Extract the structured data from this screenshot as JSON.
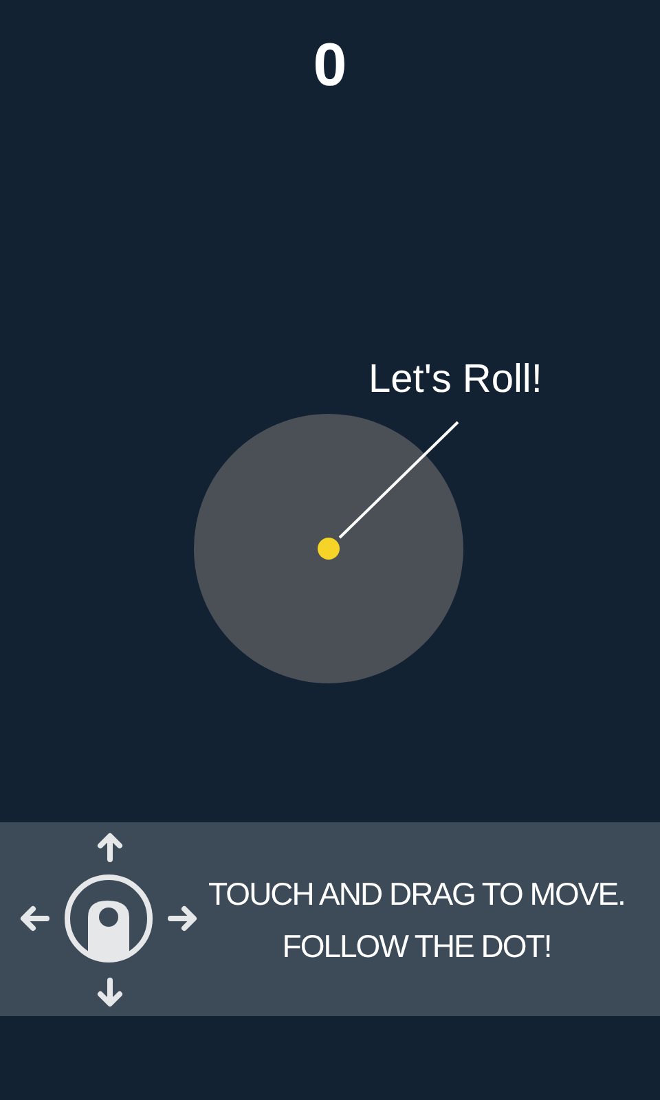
{
  "score": "0",
  "board": {
    "bubble": "Let's Roll!"
  },
  "tutorial": {
    "lines": [
      "TOUCH AND DRAG TO MOVE.",
      "FOLLOW THE DOT!"
    ]
  }
}
